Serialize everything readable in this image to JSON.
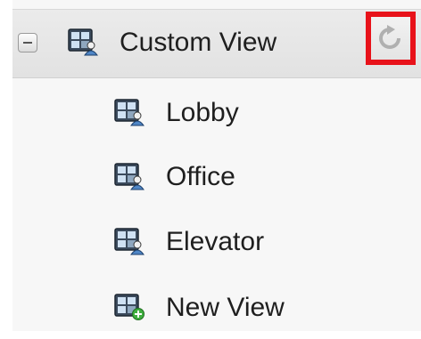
{
  "tree": {
    "group": {
      "label": "Custom View",
      "expanded": true
    },
    "items": [
      {
        "label": "Lobby",
        "icon": "camera-view-icon"
      },
      {
        "label": "Office",
        "icon": "camera-view-icon"
      },
      {
        "label": "Elevator",
        "icon": "camera-view-icon"
      },
      {
        "label": "New View",
        "icon": "add-view-icon"
      }
    ],
    "highlight_color": "#e8121a"
  }
}
